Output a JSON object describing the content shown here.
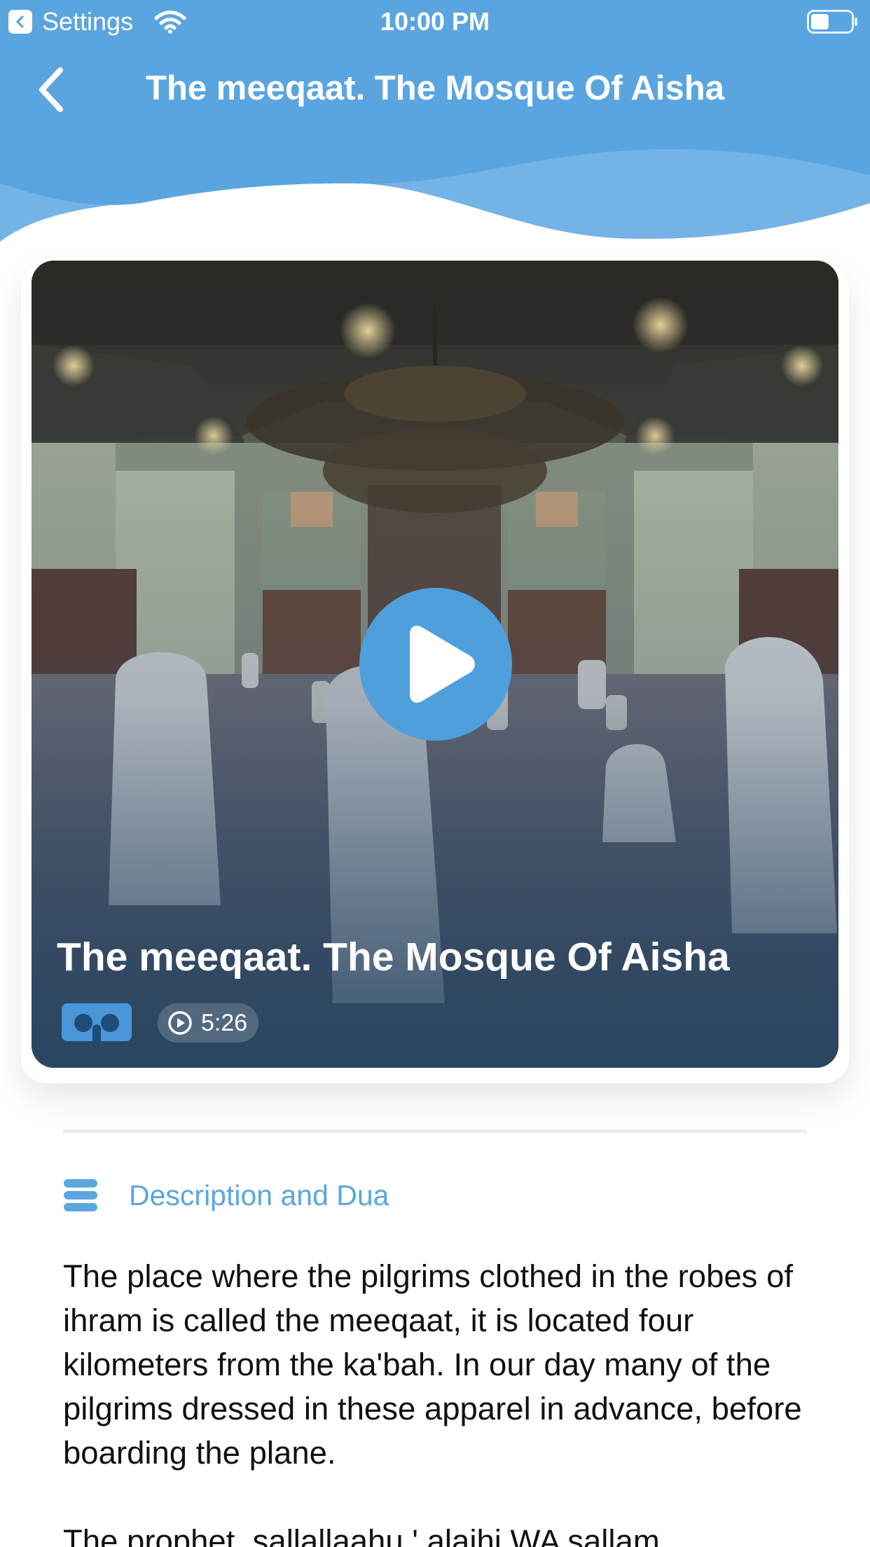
{
  "status_bar": {
    "back_app_label": "Settings",
    "time": "10:00 PM",
    "battery_level": 0.45
  },
  "nav": {
    "title": "The meeqaat. The Mosque Of Aisha"
  },
  "video": {
    "title": "The meeqaat. The Mosque Of Aisha",
    "duration": "5:26"
  },
  "section": {
    "title": "Description and Dua"
  },
  "description": {
    "paragraphs": [
      "The place where the pilgrims clothed in the robes of ihram is called the meeqaat, it is located four kilometers from the ka'bah. In our day many of the pilgrims dressed in these apparel in advance, before boarding the plane.",
      "The prophet, sallallaahu ' alaihi WA sallam"
    ]
  },
  "colors": {
    "header_blue": "#5aa5df",
    "accent_blue": "#4f9fdd",
    "section_title": "#5aa6df",
    "body_text": "#111111"
  },
  "icons": {
    "status_back": "chevron-left-icon",
    "wifi": "wifi-icon",
    "battery": "battery-icon",
    "nav_back": "chevron-left-icon",
    "play": "play-icon",
    "vr": "vr-headset-icon",
    "duration": "play-circle-icon",
    "section": "menu-icon"
  }
}
